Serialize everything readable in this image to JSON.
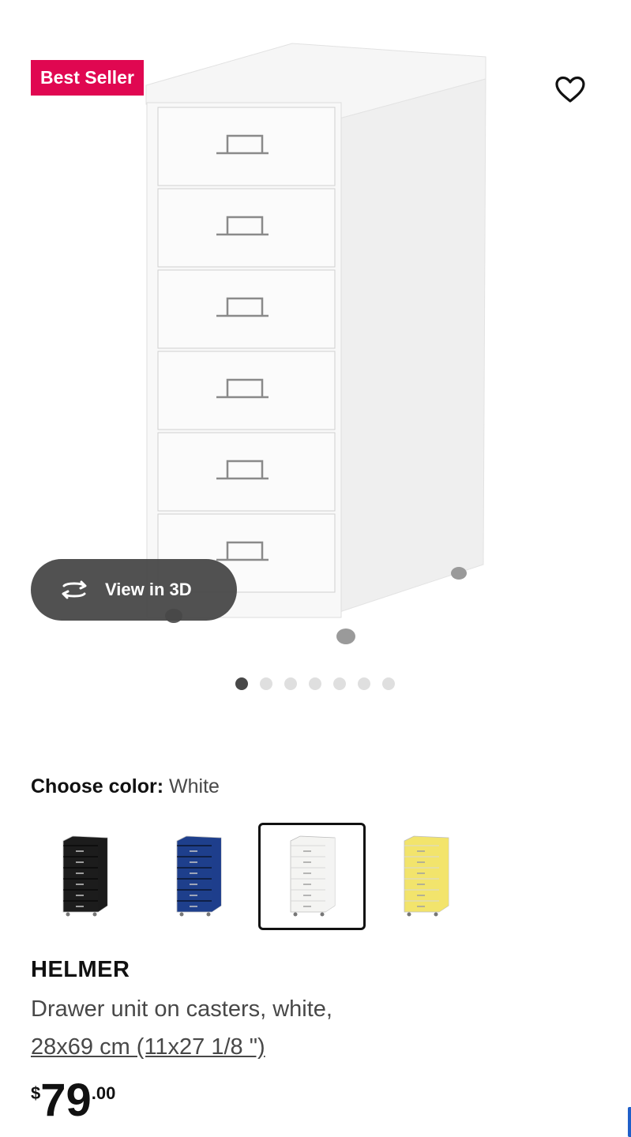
{
  "badge": {
    "label": "Best Seller"
  },
  "actions": {
    "view_3d_label": "View in 3D"
  },
  "gallery": {
    "dot_count": 7,
    "active_index": 0
  },
  "color_picker": {
    "label": "Choose color:",
    "selected_value": "White",
    "options": [
      {
        "name": "Black",
        "hex": "#1c1c1c",
        "selected": false
      },
      {
        "name": "Blue",
        "hex": "#1e3f8c",
        "selected": false
      },
      {
        "name": "White",
        "hex": "#f4f4f2",
        "selected": true
      },
      {
        "name": "Yellow",
        "hex": "#f2e46c",
        "selected": false
      }
    ]
  },
  "product": {
    "name": "HELMER",
    "description": "Drawer unit on casters, white,",
    "dimensions": "28x69 cm (11x27 1/8 \")"
  },
  "price": {
    "currency": "$",
    "integer": "79",
    "decimal": ".00"
  },
  "colors": {
    "badge_bg": "#e00751",
    "pill_bg": "#484848"
  },
  "icons": {
    "favorite": "heart-outline-icon",
    "rotate": "rotate-3d-icon"
  }
}
